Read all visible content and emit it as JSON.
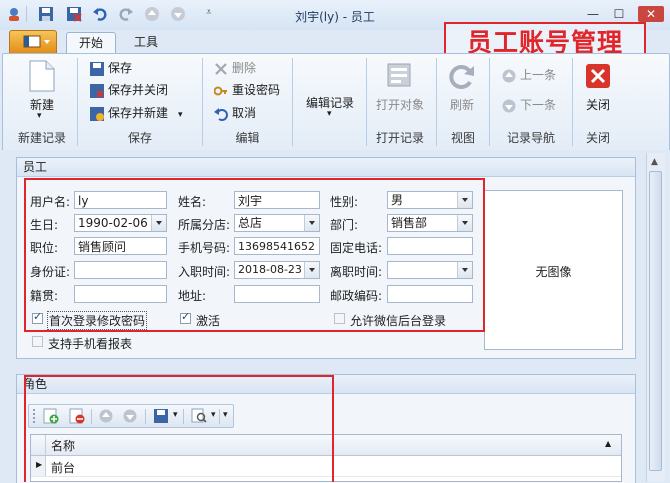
{
  "window": {
    "title": "刘宇(ly) - 员工",
    "min": "—",
    "max": "☐",
    "close": "✕"
  },
  "ribbon": {
    "tabs": [
      "开始",
      "工具"
    ],
    "groups": {
      "new": {
        "label": "新建记录",
        "new_btn": "新建"
      },
      "save": {
        "label": "保存",
        "save": "保存",
        "save_close": "保存并关闭",
        "save_new": "保存并新建"
      },
      "edit": {
        "label": "编辑",
        "delete": "删除",
        "reset_pwd": "重设密码",
        "cancel": "取消"
      },
      "editrec": {
        "edit_record": "编辑记录"
      },
      "open": {
        "label": "打开记录",
        "open_obj": "打开对象"
      },
      "view": {
        "label": "视图",
        "refresh": "刷新"
      },
      "nav": {
        "label": "记录导航",
        "prev": "上一条",
        "next": "下一条"
      },
      "close": {
        "label": "关闭",
        "close_btn": "关闭"
      }
    }
  },
  "overlay_title": "员工账号管理",
  "employee": {
    "section_title": "员工",
    "labels": {
      "username": "用户名:",
      "name": "姓名:",
      "gender": "性别:",
      "birthday": "生日:",
      "branch": "所属分店:",
      "dept": "部门:",
      "position": "职位:",
      "mobile": "手机号码:",
      "phone": "固定电话:",
      "idcard": "身份证:",
      "hire": "入职时间:",
      "leave": "离职时间:",
      "native": "籍贯:",
      "address": "地址:",
      "postcode": "邮政编码:"
    },
    "values": {
      "username": "ly",
      "name": "刘宇",
      "gender": "男",
      "birthday": "1990-02-06",
      "branch": "总店",
      "dept": "销售部",
      "position": "销售顾问",
      "mobile": "13698541652",
      "phone": "",
      "idcard": "",
      "hire": "2018-08-23",
      "leave": "",
      "native": "",
      "address": "",
      "postcode": ""
    },
    "checks": {
      "first_login": "首次登录修改密码",
      "active": "激活",
      "wechat": "允许微信后台登录",
      "mobile_report": "支持手机看报表"
    },
    "photo": "无图像"
  },
  "roles": {
    "section_title": "角色",
    "column": "名称",
    "rows": [
      "前台"
    ]
  }
}
